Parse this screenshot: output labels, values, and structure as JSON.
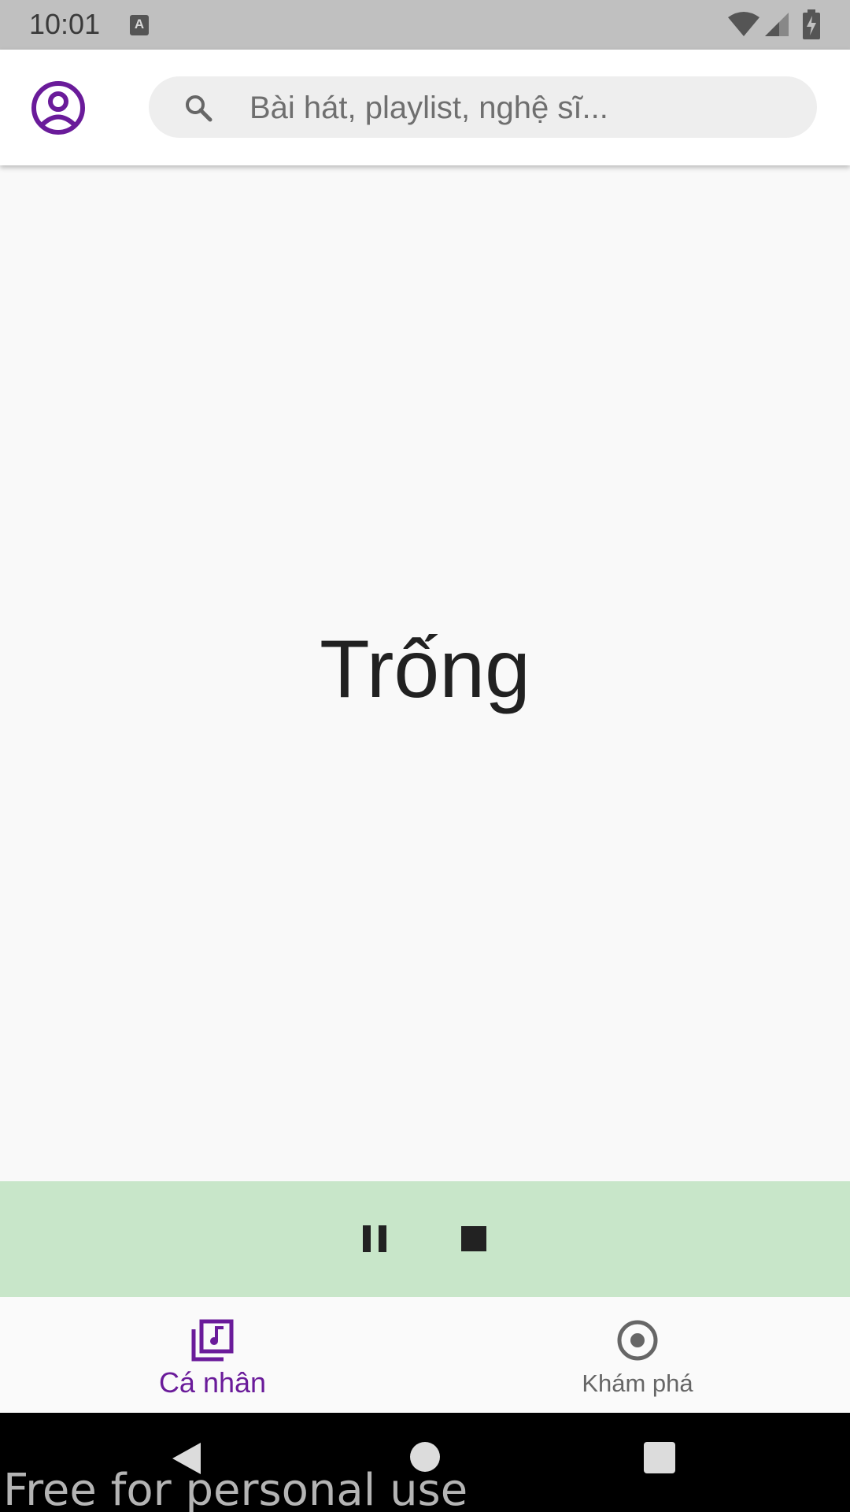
{
  "status_bar": {
    "time": "10:01",
    "notification_icon_letter": "A",
    "icons": [
      "a-notification-icon",
      "wifi-icon",
      "cell-signal-icon",
      "battery-charging-icon"
    ]
  },
  "header": {
    "profile_icon": "account-circle-icon",
    "search": {
      "icon": "search-icon",
      "placeholder": "Bài hát, playlist, nghệ sĩ...",
      "value": ""
    }
  },
  "main": {
    "empty_message": "Trống"
  },
  "player": {
    "background_color": "#c8e6c9",
    "controls": [
      "pause-icon",
      "stop-icon"
    ]
  },
  "bottom_nav": {
    "items": [
      {
        "label": "Cá nhân",
        "icon": "library-music-icon",
        "selected": true
      },
      {
        "label": "Khám phá",
        "icon": "explore-target-icon",
        "selected": false
      }
    ],
    "accent_color": "#6a1b9a",
    "inactive_color": "#666666"
  },
  "system_nav": {
    "buttons": [
      "back-icon",
      "home-icon",
      "recent-apps-icon"
    ],
    "watermark": "Free for personal use"
  }
}
